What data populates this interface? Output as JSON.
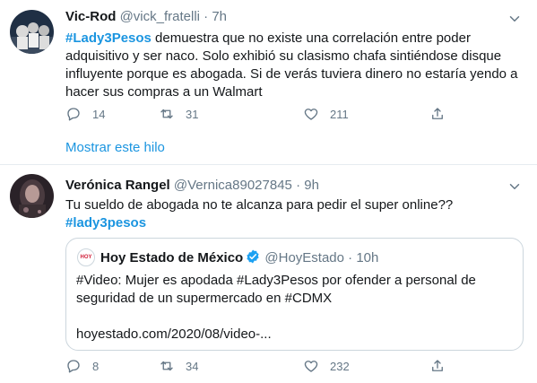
{
  "tweet1": {
    "display_name": "Vic-Rod",
    "handle": "@vick_fratelli",
    "time": "7h",
    "hashtag": "#Lady3Pesos",
    "text_line1": " demuestra que no existe una correlación entre poder",
    "text_line2": "adquisitivo y ser naco. Solo exhibió su clasismo chafa sintiéndose disque",
    "text_line3": "influyente porque es abogada. Si de verás tuviera dinero no estaría yendo a",
    "text_line4": "hacer sus compras a un Walmart",
    "replies": "14",
    "retweets": "31",
    "likes": "211"
  },
  "thread_link": "Mostrar este hilo",
  "tweet2": {
    "display_name": "Verónica Rangel",
    "handle": "@Vernica89027845",
    "time": "9h",
    "text_line1": "Tu sueldo de abogada no te alcanza para pedir el super online??",
    "hashtag": "#lady3pesos",
    "replies": "8",
    "retweets": "34",
    "likes": "232",
    "quote": {
      "logo_text": "HOY",
      "display_name": "Hoy Estado de México",
      "handle": "@HoyEstado",
      "time": "10h",
      "text_line1": "#Video: Mujer es apodada #Lady3Pesos por ofender a personal de",
      "text_line2": "seguridad de un supermercado en #CDMX",
      "link": "hoyestado.com/2020/08/video-..."
    }
  },
  "separator": "·",
  "colors": {
    "accent": "#1b95e0",
    "text": "#14171a",
    "muted": "#657786",
    "border": "#e6ecf0"
  },
  "icons": [
    "caret-down-icon",
    "reply-icon",
    "retweet-icon",
    "like-icon",
    "share-icon",
    "verified-icon"
  ]
}
